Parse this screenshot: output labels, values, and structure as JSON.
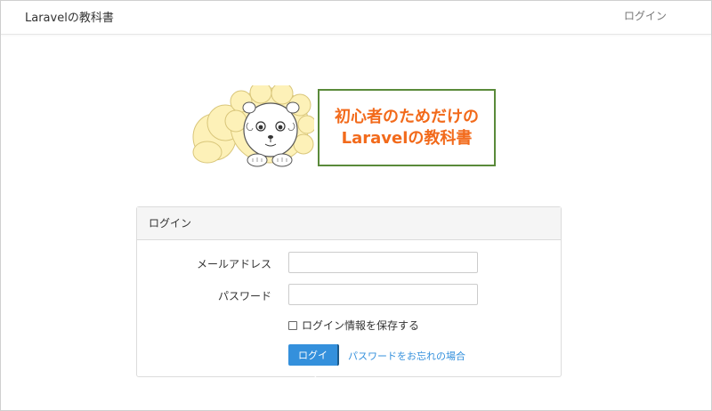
{
  "navbar": {
    "brand": "Laravelの教科書",
    "login_link": "ログイン"
  },
  "banner": {
    "title_line1": "初心者のためだけの",
    "title_line2": "Laravelの教科書",
    "title_color": "#f26a1b",
    "border_color": "#5a8a3a"
  },
  "card": {
    "header": "ログイン",
    "email_label": "メールアドレス",
    "email_value": "",
    "password_label": "パスワード",
    "password_value": "",
    "remember_label": "ログイン情報を保存する",
    "remember_checked": false,
    "login_button": "ログイン",
    "forgot_link": "パスワードをお忘れの場合",
    "accent_color": "#3490dc"
  }
}
